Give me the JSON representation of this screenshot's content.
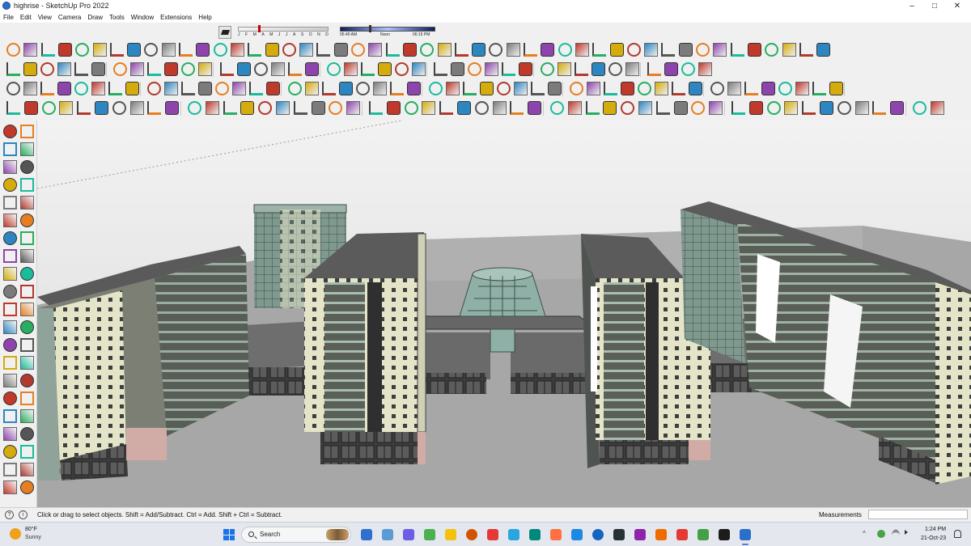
{
  "window": {
    "title": "highrise - SketchUp Pro 2022",
    "controls": {
      "minimize": "–",
      "maximize": "□",
      "close": "✕"
    }
  },
  "menu": [
    "File",
    "Edit",
    "View",
    "Camera",
    "Draw",
    "Tools",
    "Window",
    "Extensions",
    "Help"
  ],
  "shadow_settings": {
    "months": [
      "J",
      "F",
      "M",
      "A",
      "M",
      "J",
      "J",
      "A",
      "S",
      "O",
      "N",
      "D"
    ],
    "start_time": "05:40 AM",
    "mid_time": "Noon",
    "end_time": "06:15 PM"
  },
  "statusbar": {
    "hint": "Click or drag to select objects. Shift = Add/Subtract. Ctrl = Add. Shift + Ctrl = Subtract.",
    "measurements_label": "Measurements",
    "measurements_value": ""
  },
  "taskbar": {
    "weather_temp": "80°F",
    "weather_desc": "Sunny",
    "search_label": "Search",
    "time": "1:24 PM",
    "date": "21-Oct-23"
  },
  "colors": {
    "sky": "#e8e8e8",
    "ground": "#a6a6a6",
    "facade": "#e2e3c6",
    "glass": "#7b958a",
    "roof": "#5a5a5a",
    "accent": "#d0a7a2"
  }
}
